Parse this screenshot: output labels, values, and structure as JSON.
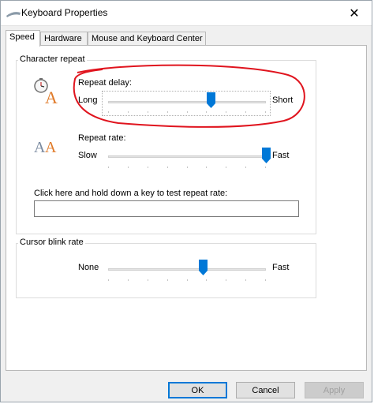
{
  "window": {
    "title": "Keyboard Properties",
    "close_glyph": "✕"
  },
  "tabs": [
    {
      "label": "Speed",
      "active": true
    },
    {
      "label": "Hardware",
      "active": false
    },
    {
      "label": "Mouse and Keyboard Center",
      "active": false
    }
  ],
  "character_repeat": {
    "group_label": "Character repeat",
    "repeat_delay": {
      "label": "Repeat delay:",
      "min_label": "Long",
      "max_label": "Short",
      "value_fraction": 0.65,
      "icon": "clock-letter-a-icon"
    },
    "repeat_rate": {
      "label": "Repeat rate:",
      "min_label": "Slow",
      "max_label": "Fast",
      "value_fraction": 1.0,
      "icon": "double-letter-a-icon"
    },
    "test": {
      "label": "Click here and hold down a key to test repeat rate:",
      "value": ""
    }
  },
  "cursor_blink": {
    "group_label": "Cursor blink rate",
    "min_label": "None",
    "max_label": "Fast",
    "value_fraction": 0.6
  },
  "buttons": {
    "ok": "OK",
    "cancel": "Cancel",
    "apply": "Apply"
  },
  "colors": {
    "accent": "#0078d7",
    "annotation": "#e0141e"
  }
}
